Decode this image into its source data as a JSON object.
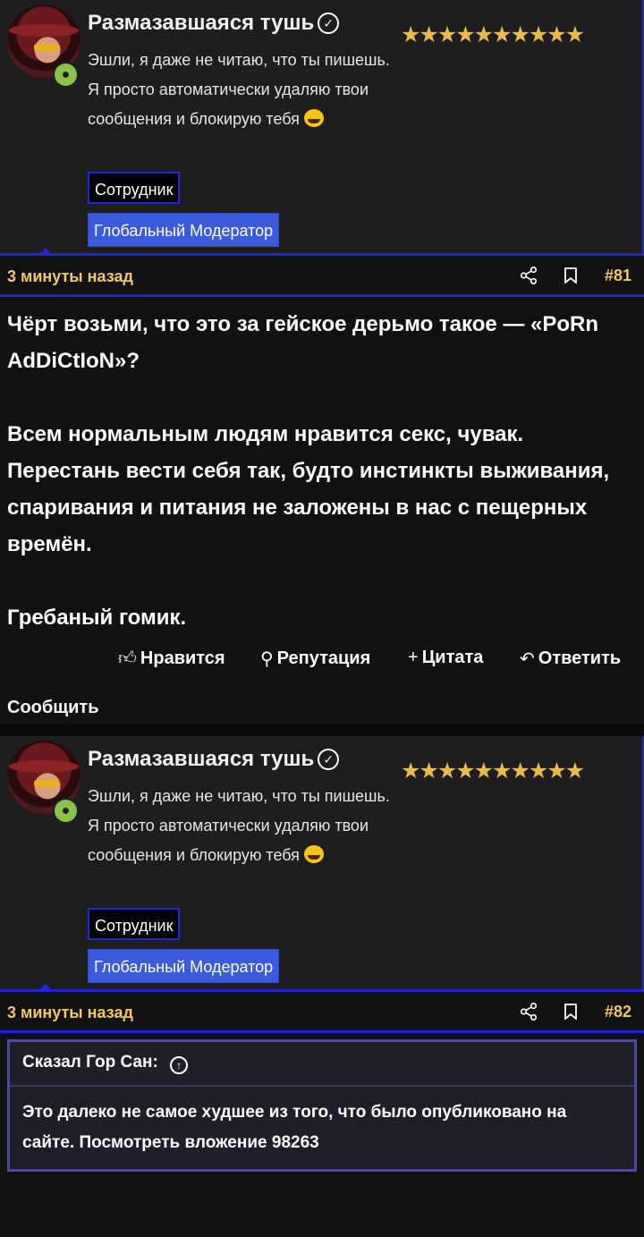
{
  "posts": [
    {
      "author": {
        "name": "Размазавшаяся тушь",
        "stars": "★★★★★★★★★★",
        "status": "Эшли, я даже не читаю, что ты пишешь. Я просто автоматически удаляю твои сообщения и блокирую тебя",
        "badge_staff": "Сотрудник",
        "badge_role": "Глобальный Модератор"
      },
      "time": "3 минуты назад",
      "number": "#81",
      "body": [
        "Чёрт возьми, что это за гейское дерьмо такое — «PoRn AdDiCtIoN»?",
        "Всем нормальным людям нравится секс, чувак. Перестань вести себя так, будто инстинкты выживания, спаривания и питания не заложены в нас с пещерных времён.",
        "Гребаный гомик."
      ],
      "actions": {
        "like": "Нравится",
        "reputation": "Репутация",
        "quote": "Цитата",
        "reply": "Ответить",
        "report": "Сообщить"
      }
    },
    {
      "author": {
        "name": "Размазавшаяся тушь",
        "stars": "★★★★★★★★★★",
        "status": "Эшли, я даже не читаю, что ты пишешь. Я просто автоматически удаляю твои сообщения и блокирую тебя",
        "badge_staff": "Сотрудник",
        "badge_role": "Глобальный Модератор"
      },
      "time": "3 минуты назад",
      "number": "#82",
      "quote": {
        "header": "Сказал Гор Сан:",
        "text": "Это далеко не самое худшее из того, что было опубликовано на сайте. Посмотреть вложение 98263"
      }
    }
  ],
  "colors": {
    "accent": "#2323d6",
    "meta_text": "#f0c765",
    "stars": "#e9bb4f",
    "online": "#8bc34a"
  }
}
